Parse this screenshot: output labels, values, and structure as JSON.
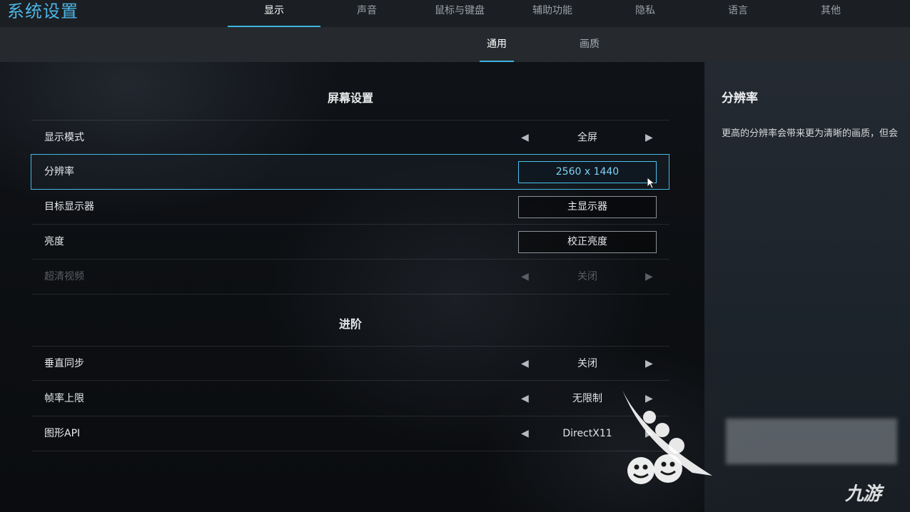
{
  "app_title": "系统设置",
  "main_tabs": [
    {
      "label": "显示",
      "active": true
    },
    {
      "label": "声音",
      "active": false
    },
    {
      "label": "鼠标与键盘",
      "active": false
    },
    {
      "label": "辅助功能",
      "active": false
    },
    {
      "label": "隐私",
      "active": false
    },
    {
      "label": "语言",
      "active": false
    },
    {
      "label": "其他",
      "active": false
    }
  ],
  "sub_tabs": [
    {
      "label": "通用",
      "active": true
    },
    {
      "label": "画质",
      "active": false
    }
  ],
  "sections": {
    "screen": {
      "title": "屏幕设置",
      "rows": [
        {
          "label": "显示模式",
          "value": "全屏",
          "control": "arrows"
        },
        {
          "label": "分辨率",
          "value": "2560 x 1440",
          "control": "button",
          "selected": true
        },
        {
          "label": "目标显示器",
          "value": "主显示器",
          "control": "button"
        },
        {
          "label": "亮度",
          "value": "校正亮度",
          "control": "button"
        },
        {
          "label": "超清视频",
          "value": "关闭",
          "control": "arrows",
          "disabled": true
        }
      ]
    },
    "advanced": {
      "title": "进阶",
      "rows": [
        {
          "label": "垂直同步",
          "value": "关闭",
          "control": "arrows"
        },
        {
          "label": "帧率上限",
          "value": "无限制",
          "control": "arrows"
        },
        {
          "label": "图形API",
          "value": "DirectX11",
          "control": "arrows"
        }
      ]
    }
  },
  "arrows": {
    "left": "◀",
    "right": "▶"
  },
  "info_panel": {
    "title": "分辨率",
    "description": "更高的分辨率会带来更为清晰的画质，但会"
  },
  "watermark": {
    "logo_text": "九游"
  },
  "colors": {
    "accent": "#3fb3e0",
    "title_blue": "#4cb6e6"
  },
  "icons": {
    "cursor": "mouse-pointer-icon",
    "arrow_left": "caret-left-icon",
    "arrow_right": "caret-right-icon"
  }
}
